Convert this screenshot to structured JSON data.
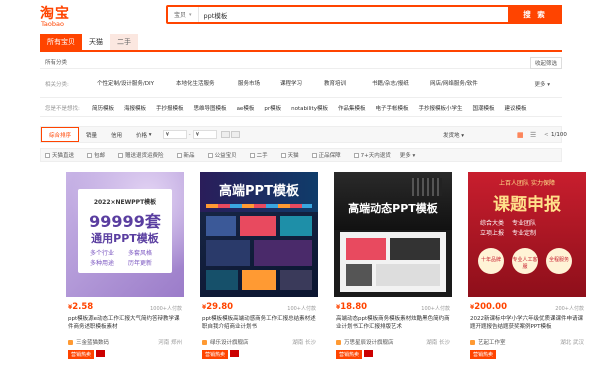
{
  "logo": {
    "cn": "淘宝",
    "en": "Taobao"
  },
  "search": {
    "type": "宝贝",
    "value": "ppt模板",
    "button": "搜 索"
  },
  "tabs": [
    "所有宝贝",
    "天猫",
    "二手"
  ],
  "breadcrumb": "所有分类",
  "collapse": "收起筛选",
  "related_label": "相关分类:",
  "related": [
    "个性定制/设计服务/DIY",
    "本地化生活服务",
    "服务市场",
    "课程学习",
    "教育培训",
    "书籍/杂志/报纸",
    "网店/网络服务/软件"
  ],
  "more": "更多",
  "also_label": "您是不是想找:",
  "also": [
    "简历模板",
    "海报模板",
    "手抄报模板",
    "思维导图模板",
    "ae模板",
    "pr模板",
    "notability模板",
    "作品集模板",
    "电子手帐模板",
    "手抄报模板小学生",
    "国潮模板",
    "建议模板"
  ],
  "sort": [
    "综合排序",
    "销量",
    "信用",
    "价格"
  ],
  "price_from": "¥",
  "price_to": "¥",
  "ship_from": "发货地",
  "page": "1/100",
  "filters": [
    "天猫直送",
    "包邮",
    "赠送退货运费险",
    "新品",
    "公益宝贝",
    "二手",
    "天猫",
    "正品保障",
    "7+天内退货"
  ],
  "filter_more": "更多",
  "products": [
    {
      "price": "2.58",
      "sales": "1000+人付款",
      "title": "ppt模板源e动态工作汇报大气简约答辩教学课件商务述职模板素材",
      "shop": "三金蓝猫数码",
      "loc": "河南 郑州",
      "badge": "营销热卖",
      "img": {
        "line1": "2022×NEWPPT模板",
        "line2": "99999套",
        "line3": "通用PPT模板",
        "s1": "多个行业",
        "s2": "多套风格",
        "s3": "多种用途",
        "s4": "历年更新"
      }
    },
    {
      "price": "29.80",
      "sales": "100+人付款",
      "title": "ppt模板模板高端动感商务工作汇报总结素材述职自我介绍商业计划书",
      "shop": "绿乐设计旗舰店",
      "loc": "湖南 长沙",
      "badge": "营销热卖",
      "img": {
        "line1": "高端PPT模板"
      }
    },
    {
      "price": "18.80",
      "sales": "100+人付款",
      "title": "高端动态ppt模板商务模板素材炫酷黑色简约商业计划书工作汇报排版艺术",
      "shop": "万思星辰设计旗舰店",
      "loc": "湖南 长沙",
      "badge": "营销热卖",
      "img": {
        "line1": "高端动态PPT模板"
      }
    },
    {
      "price": "200.00",
      "sales": "200+人付款",
      "title": "2022新课标中学小学六年级优质课课件申请课题开题报告结题获奖案例PPT模板",
      "shop": "艺起工作室",
      "loc": "湖北 武汉",
      "badge": "营销热卖",
      "img": {
        "line0": "上百人团队 实力保障",
        "line1": "课题申报",
        "s1": "综合大类",
        "s2": "专业团队",
        "s3": "立项上报",
        "s4": "专业定制",
        "r1": "十年品牌",
        "r2": "专业人工客服",
        "r3": "全程服务"
      }
    }
  ],
  "colors": {
    "accent": "#ff4400"
  }
}
